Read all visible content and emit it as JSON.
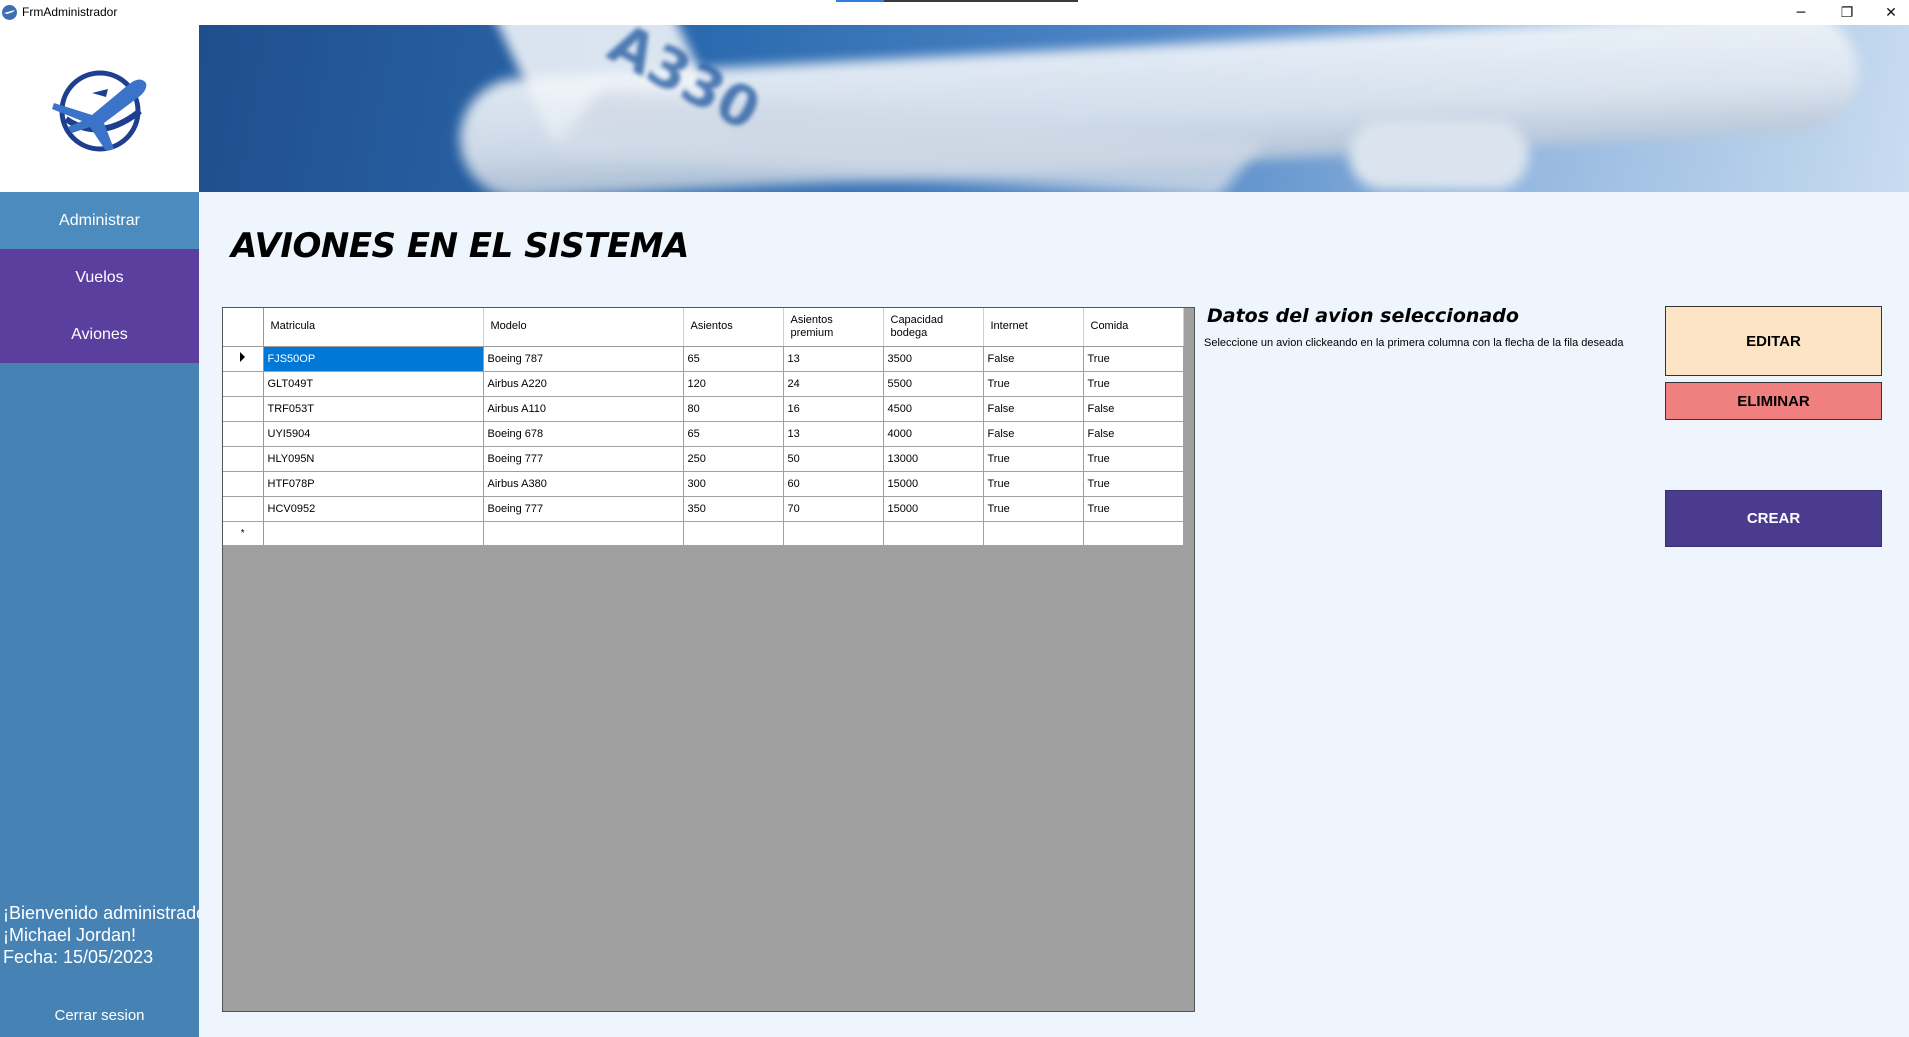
{
  "window": {
    "title": "FrmAdministrador",
    "minimize_glyph": "─",
    "maximize_glyph": "❐",
    "close_glyph": "✕"
  },
  "sidebar": {
    "logo_icon": "airplane-globe-logo",
    "items": [
      {
        "label": "Administrar"
      },
      {
        "label": "Vuelos"
      },
      {
        "label": "Aviones"
      }
    ],
    "welcome_line1": "¡Bienvenido administrador",
    "welcome_line2": "¡Michael Jordan!",
    "date_line": "Fecha: 15/05/2023",
    "logout_label": "Cerrar sesion"
  },
  "banner": {
    "tail_text": "A330"
  },
  "main": {
    "title": "AVIONES EN EL SISTEMA"
  },
  "grid": {
    "columns": [
      "Matricula",
      "Modelo",
      "Asientos",
      "Asientos premium",
      "Capacidad bodega",
      "Internet",
      "Comida"
    ],
    "rows": [
      [
        "FJS50OP",
        "Boeing 787",
        "65",
        "13",
        "3500",
        "False",
        "True"
      ],
      [
        "GLT049T",
        "Airbus A220",
        "120",
        "24",
        "5500",
        "True",
        "True"
      ],
      [
        "TRF053T",
        "Airbus A110",
        "80",
        "16",
        "4500",
        "False",
        "False"
      ],
      [
        "UYI5904",
        "Boeing 678",
        "65",
        "13",
        "4000",
        "False",
        "False"
      ],
      [
        "HLY095N",
        "Boeing 777",
        "250",
        "50",
        "13000",
        "True",
        "True"
      ],
      [
        "HTF078P",
        "Airbus A380",
        "300",
        "60",
        "15000",
        "True",
        "True"
      ],
      [
        "HCV0952",
        "Boeing 777",
        "350",
        "70",
        "15000",
        "True",
        "True"
      ]
    ],
    "selected_row": 0,
    "new_row_marker": "*"
  },
  "details": {
    "title": "Datos del avion seleccionado",
    "hint": "Seleccione un avion clickeando en la primera columna con la flecha de la fila deseada"
  },
  "buttons": {
    "edit": "EDITAR",
    "delete": "ELIMINAR",
    "create": "CREAR"
  },
  "colors": {
    "sidebar": "#4682b4",
    "nav_active": "#5b3f9e",
    "edit_button": "#fce4c4",
    "delete_button": "#f08080",
    "create_button": "#4b3b8f",
    "selection": "#0078d7"
  }
}
